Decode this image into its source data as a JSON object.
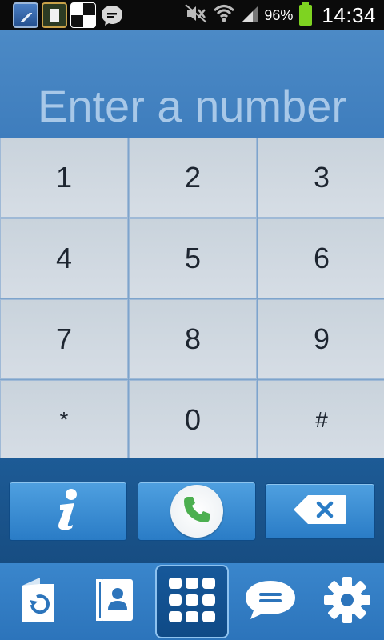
{
  "status_bar": {
    "notifications": [
      "gallery-icon",
      "running-app-icon",
      "chess-app-icon",
      "chat-icon"
    ],
    "icons": [
      "mute-icon",
      "wifi-icon",
      "signal-icon"
    ],
    "battery_percent": "96%",
    "time": "14:34",
    "colors": {
      "background": "#0b0b0b",
      "battery": "#7ed321"
    }
  },
  "display": {
    "placeholder": "Enter a number",
    "value": ""
  },
  "keypad": {
    "keys": [
      "1",
      "2",
      "3",
      "4",
      "5",
      "6",
      "7",
      "8",
      "9",
      "*",
      "0",
      "#"
    ]
  },
  "actions": {
    "info_label": "i",
    "call_icon": "phone-icon",
    "delete_icon": "backspace-icon"
  },
  "bottom_nav": {
    "items": [
      {
        "icon": "recent-calls-icon",
        "selected": false
      },
      {
        "icon": "contacts-icon",
        "selected": false
      },
      {
        "icon": "dialpad-icon",
        "selected": true
      },
      {
        "icon": "messages-icon",
        "selected": false
      },
      {
        "icon": "settings-icon",
        "selected": false
      }
    ]
  },
  "colors": {
    "accent": "#3e7dbd",
    "keypad_background": "#d0d9e1",
    "action_bar": "#1d5b96",
    "call_green": "#4caf50"
  }
}
